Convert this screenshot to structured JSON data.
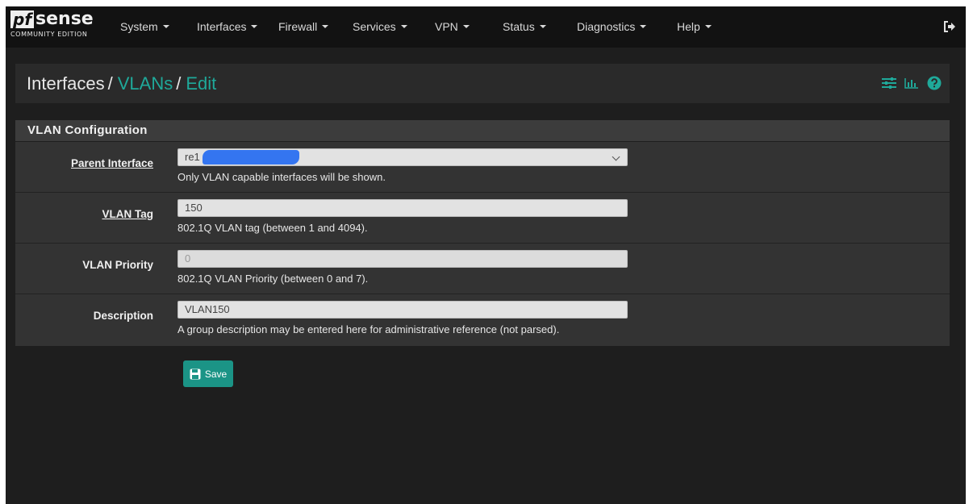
{
  "brand": {
    "main_left": "pf",
    "main_right": "sense",
    "sub": "COMMUNITY EDITION"
  },
  "nav": [
    {
      "label": "System",
      "name": "nav-system"
    },
    {
      "label": "Interfaces",
      "name": "nav-interfaces"
    },
    {
      "label": "Firewall",
      "name": "nav-firewall"
    },
    {
      "label": "Services",
      "name": "nav-services"
    },
    {
      "label": "VPN",
      "name": "nav-vpn"
    },
    {
      "label": "Status",
      "name": "nav-status"
    },
    {
      "label": "Diagnostics",
      "name": "nav-diagnostics"
    },
    {
      "label": "Help",
      "name": "nav-help"
    }
  ],
  "breadcrumb": {
    "part1": "Interfaces",
    "part2": "VLANs",
    "part3": "Edit",
    "separator": "/"
  },
  "panel": {
    "title": "VLAN Configuration",
    "rows": [
      {
        "label": "Parent Interface",
        "value": "re1",
        "help": "Only VLAN capable interfaces will be shown."
      },
      {
        "label": "VLAN Tag",
        "value": "150",
        "help": "802.1Q VLAN tag (between 1 and 4094)."
      },
      {
        "label": "VLAN Priority",
        "value": "0",
        "help": "802.1Q VLAN Priority (between 0 and 7)."
      },
      {
        "label": "Description",
        "value": "VLAN150",
        "help": "A group description may be entered here for administrative reference (not parsed)."
      }
    ]
  },
  "save_label": "Save",
  "icons": {
    "logout": "sign-out-icon",
    "settings": "sliders-icon",
    "chart": "bar-chart-icon",
    "help": "question-circle-icon"
  },
  "colors": {
    "accent": "#1fa99a",
    "button": "#1b9486",
    "navbar": "#121212"
  }
}
